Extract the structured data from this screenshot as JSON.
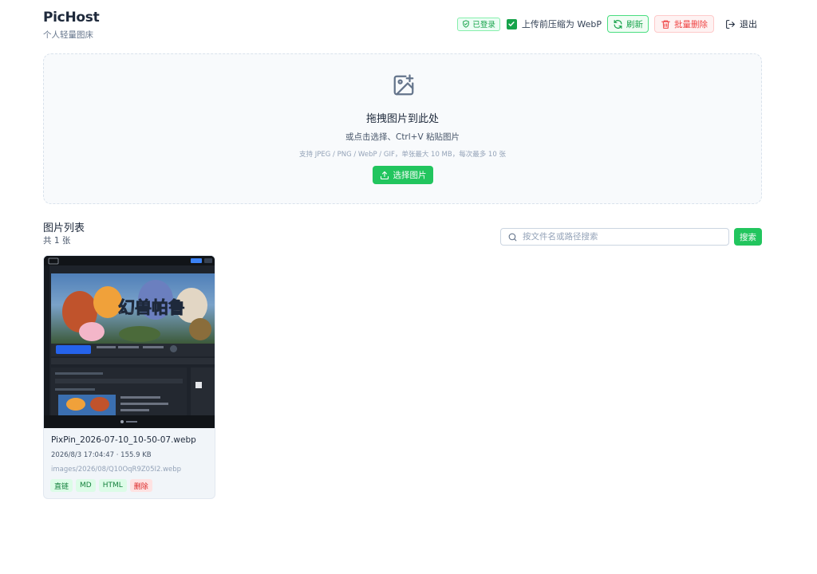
{
  "header": {
    "title": "PicHost",
    "subtitle": "个人轻量图床",
    "logged_in_badge": "已登录",
    "compress_label": "上传前压缩为 WebP",
    "compress_checked": true,
    "refresh_label": "刷新",
    "bulk_delete_label": "批量删除",
    "logout_label": "退出"
  },
  "upload": {
    "title": "拖拽图片到此处",
    "subtitle": "或点击选择、Ctrl+V 粘贴图片",
    "hint": "支持 JPEG / PNG / WebP / GIF，单张最大 10 MB，每次最多 10 张",
    "button_label": "选择图片"
  },
  "list": {
    "title": "图片列表",
    "count": "共 1 张",
    "search_placeholder": "按文件名或路径搜索",
    "search_button": "搜索"
  },
  "images": [
    {
      "filename": "PixPin_2026-07-10_10-50-07.webp",
      "meta": "2026/8/3 17:04:47 · 155.9 KB",
      "path": "images/2026/08/Q10OqR9Z05I2.webp",
      "thumbnail_text": "幻兽帕鲁",
      "actions": [
        "直链",
        "MD",
        "HTML",
        "删除"
      ]
    }
  ],
  "colors": {
    "accent": "#22c55e",
    "danger": "#ef4444",
    "text": "#1e293b"
  }
}
